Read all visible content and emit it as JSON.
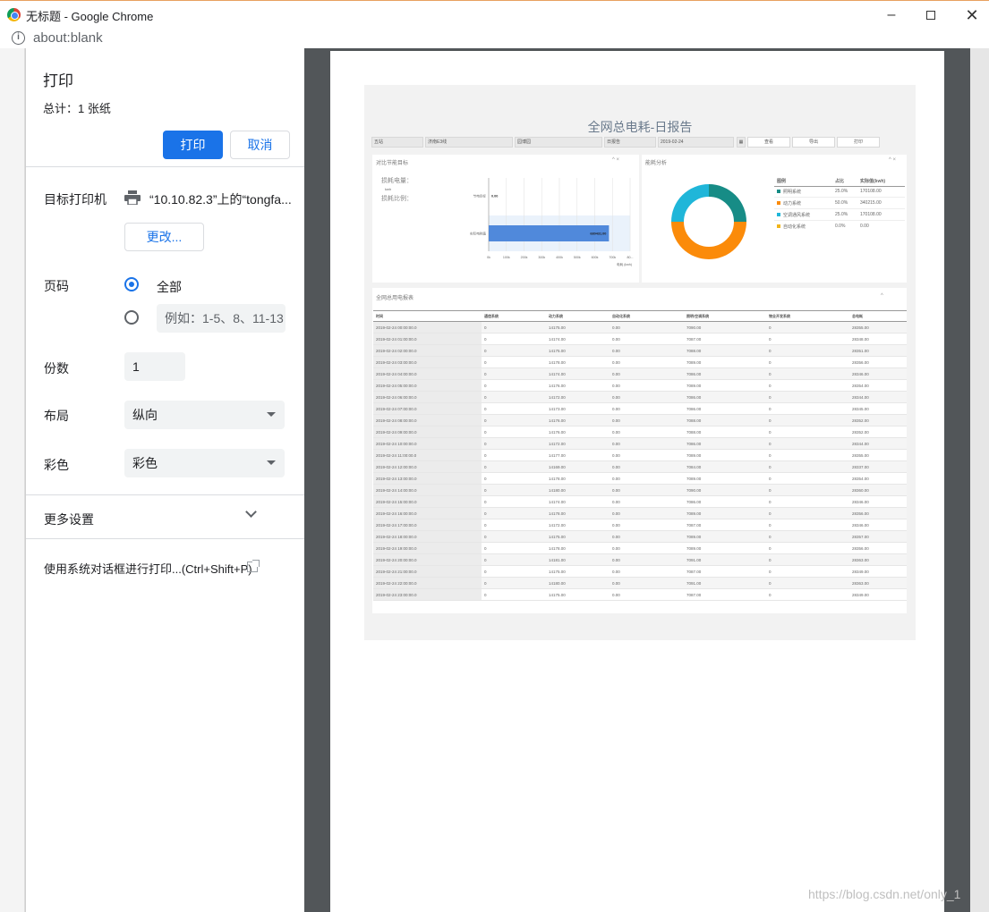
{
  "window": {
    "title": "无标题 - Google Chrome",
    "url": "about:blank"
  },
  "dialog": {
    "title": "打印",
    "total": "总计：1 张纸",
    "print_label": "打印",
    "cancel_label": "取消",
    "printer_label": "目标打印机",
    "printer_name": "“10.10.82.3”上的“tongfa...",
    "change_label": "更改...",
    "pages_label": "页码",
    "pages_all": "全部",
    "pages_placeholder": "例如：1-5、8、11-13",
    "copies_label": "份数",
    "copies_value": "1",
    "layout_label": "布局",
    "layout_value": "纵向",
    "color_label": "彩色",
    "color_value": "彩色",
    "more_settings": "更多设置",
    "system_dialog": "使用系统对话框进行打印...(Ctrl+Shift+P)"
  },
  "report": {
    "title": "全网总电耗-日报告",
    "filters": [
      "五站",
      "济南E3线",
      "园博园",
      "日报告",
      "2019-02-24"
    ],
    "buttons": [
      "查看",
      "导出",
      "打印"
    ],
    "left_panel": {
      "title": "对比节能目标",
      "label1": "损耗电量：",
      "unit1": "kwh",
      "label2": "损耗比例：",
      "bars": [
        {
          "label": "节电目标",
          "value": 0,
          "value_text": "0.00"
        },
        {
          "label": "实际电耗值",
          "value": 680431,
          "value_text": "680431.00"
        }
      ],
      "axis_ticks": [
        "0k",
        "100k",
        "200k",
        "300k",
        "400k",
        "500k",
        "600k",
        "700k",
        "80..."
      ],
      "axis_label": "电耗 (kwh)",
      "xlim": [
        0,
        800000
      ]
    },
    "right_panel": {
      "title": "能耗分析",
      "legend_headers": [
        "图例",
        "占比",
        "实际值(kwh)"
      ],
      "items": [
        {
          "name": "照明系统",
          "pct": "25.0%",
          "value": "170108.00",
          "color": "#178c86"
        },
        {
          "name": "动力系统",
          "pct": "50.0%",
          "value": "340215.00",
          "color": "#fb8b0a"
        },
        {
          "name": "空调通风系统",
          "pct": "25.0%",
          "value": "170108.00",
          "color": "#1fb6d9"
        },
        {
          "name": "自动化系统",
          "pct": "0.0%",
          "value": "0.00",
          "color": "#f1b51a"
        }
      ]
    },
    "table": {
      "title": "全网总用电报表",
      "headers": [
        "时间",
        "通信系统",
        "动力系统",
        "自动化系统",
        "照明/空调系统",
        "物业开发系统",
        "总电耗"
      ],
      "rows": [
        [
          "2019-02-24 00:00:00.0",
          "0",
          "14175.00",
          "0.00",
          "7090.00",
          "0",
          "28355.00"
        ],
        [
          "2019-02-24 01:00:00.0",
          "0",
          "14174.00",
          "0.00",
          "7087.00",
          "0",
          "28348.00"
        ],
        [
          "2019-02-24 02:00:00.0",
          "0",
          "14175.00",
          "0.00",
          "7088.00",
          "0",
          "28351.00"
        ],
        [
          "2019-02-24 03:00:00.0",
          "0",
          "14178.00",
          "0.00",
          "7089.00",
          "0",
          "28356.00"
        ],
        [
          "2019-02-24 04:00:00.0",
          "0",
          "14174.00",
          "0.00",
          "7086.00",
          "0",
          "28346.00"
        ],
        [
          "2019-02-24 05:00:00.0",
          "0",
          "14176.00",
          "0.00",
          "7089.00",
          "0",
          "28354.00"
        ],
        [
          "2019-02-24 06:00:00.0",
          "0",
          "14172.00",
          "0.00",
          "7086.00",
          "0",
          "28344.00"
        ],
        [
          "2019-02-24 07:00:00.0",
          "0",
          "14173.00",
          "0.00",
          "7086.00",
          "0",
          "28345.00"
        ],
        [
          "2019-02-24 08:00:00.0",
          "0",
          "14176.00",
          "0.00",
          "7088.00",
          "0",
          "28352.00"
        ],
        [
          "2019-02-24 09:00:00.0",
          "0",
          "14176.00",
          "0.00",
          "7088.00",
          "0",
          "28352.00"
        ],
        [
          "2019-02-24 10:00:00.0",
          "0",
          "14172.00",
          "0.00",
          "7086.00",
          "0",
          "28344.00"
        ],
        [
          "2019-02-24 11:00:00.0",
          "0",
          "14177.00",
          "0.00",
          "7089.00",
          "0",
          "28355.00"
        ],
        [
          "2019-02-24 12:00:00.0",
          "0",
          "14169.00",
          "0.00",
          "7084.00",
          "0",
          "28337.00"
        ],
        [
          "2019-02-24 13:00:00.0",
          "0",
          "14178.00",
          "0.00",
          "7089.00",
          "0",
          "28354.00"
        ],
        [
          "2019-02-24 14:00:00.0",
          "0",
          "14180.00",
          "0.00",
          "7090.00",
          "0",
          "28360.00"
        ],
        [
          "2019-02-24 15:00:00.0",
          "0",
          "14174.00",
          "0.00",
          "7086.00",
          "0",
          "28346.00"
        ],
        [
          "2019-02-24 16:00:00.0",
          "0",
          "14178.00",
          "0.00",
          "7089.00",
          "0",
          "28356.00"
        ],
        [
          "2019-02-24 17:00:00.0",
          "0",
          "14172.00",
          "0.00",
          "7087.00",
          "0",
          "28346.00"
        ],
        [
          "2019-02-24 18:00:00.0",
          "0",
          "14175.00",
          "0.00",
          "7089.00",
          "0",
          "28357.00"
        ],
        [
          "2019-02-24 19:00:00.0",
          "0",
          "14178.00",
          "0.00",
          "7089.00",
          "0",
          "28356.00"
        ],
        [
          "2019-02-24 20:00:00.0",
          "0",
          "14181.00",
          "0.00",
          "7091.00",
          "0",
          "28363.00"
        ],
        [
          "2019-02-24 21:00:00.0",
          "0",
          "14175.00",
          "0.00",
          "7087.00",
          "0",
          "28349.00"
        ],
        [
          "2019-02-24 22:00:00.0",
          "0",
          "14180.00",
          "0.00",
          "7091.00",
          "0",
          "28363.00"
        ],
        [
          "2019-02-24 23:00:00.0",
          "0",
          "14175.00",
          "0.00",
          "7087.00",
          "0",
          "28349.00"
        ]
      ]
    }
  },
  "watermark": "https://blog.csdn.net/only_1"
}
